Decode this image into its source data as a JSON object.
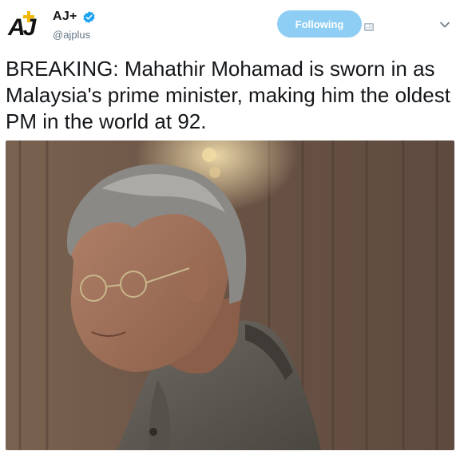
{
  "account": {
    "display_name": "AJ+",
    "handle": "@ajplus",
    "logo_text": "AJ",
    "verified": true
  },
  "follow_button": {
    "label": "Following"
  },
  "icons": {
    "notifications": "notification-icon",
    "more": "chevron-down-icon",
    "verified": "verified-badge-icon"
  },
  "tweet": {
    "text": "BREAKING: Mahathir Mohamad is sworn in as Malaysia's prime minister, making him the oldest PM in the world at 92."
  },
  "colors": {
    "follow_button_bg": "#8ecdf4",
    "verified_blue": "#1da1f2",
    "handle_gray": "#657786"
  }
}
